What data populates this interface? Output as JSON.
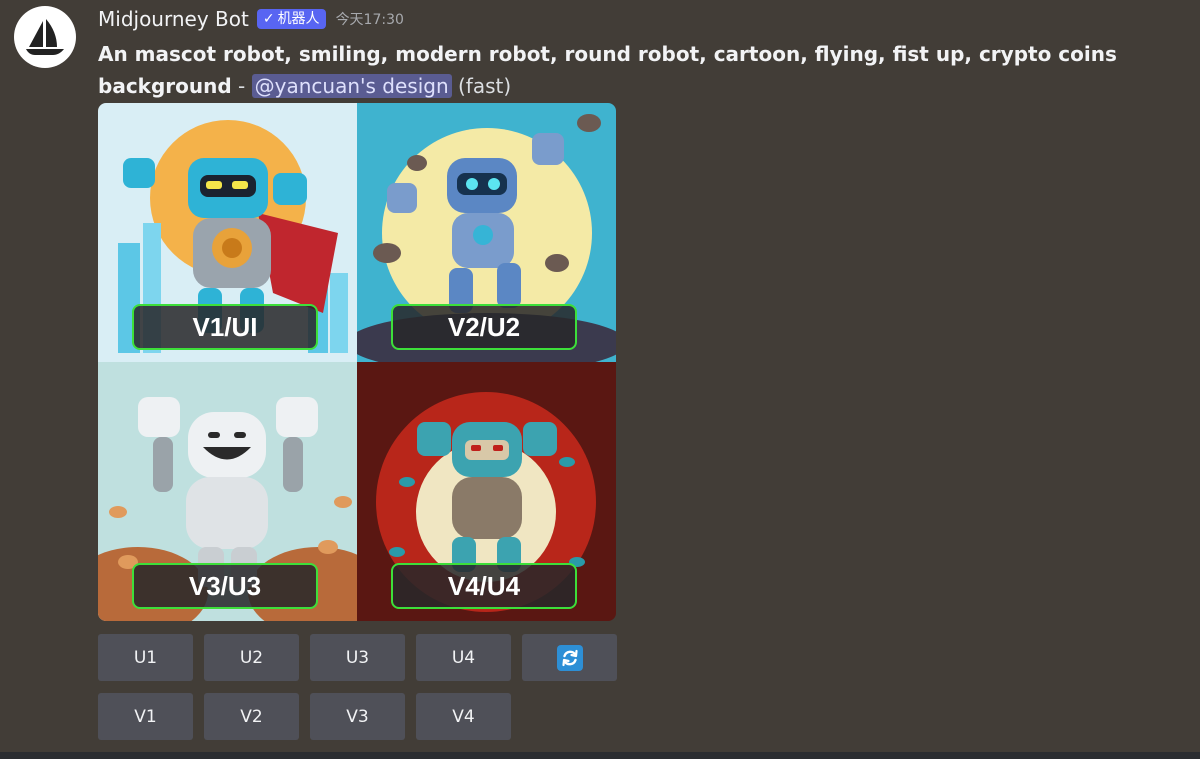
{
  "bot": {
    "name": "Midjourney Bot",
    "tag_check": "✓",
    "tag": "机器人",
    "timestamp": "今天17:30"
  },
  "message": {
    "prompt": "An mascot robot, smiling, modern robot, round robot, cartoon, flying, fist up, crypto coins background",
    "separator": " - ",
    "mention": "@yancuan's design",
    "mode": "(fast)"
  },
  "grid": {
    "labels": [
      "V1/UI",
      "V2/U2",
      "V3/U3",
      "V4/U4"
    ]
  },
  "upscale_buttons": [
    "U1",
    "U2",
    "U3",
    "U4"
  ],
  "variation_buttons": [
    "V1",
    "V2",
    "V3",
    "V4"
  ],
  "icons": {
    "reroll": "refresh-icon",
    "avatar": "sailboat-logo"
  },
  "colors": {
    "background": "#423d37",
    "button": "#4f5058",
    "label_border": "#3ddf3a",
    "bot_tag": "#5865f2",
    "mention_bg": "#5a5c92"
  }
}
